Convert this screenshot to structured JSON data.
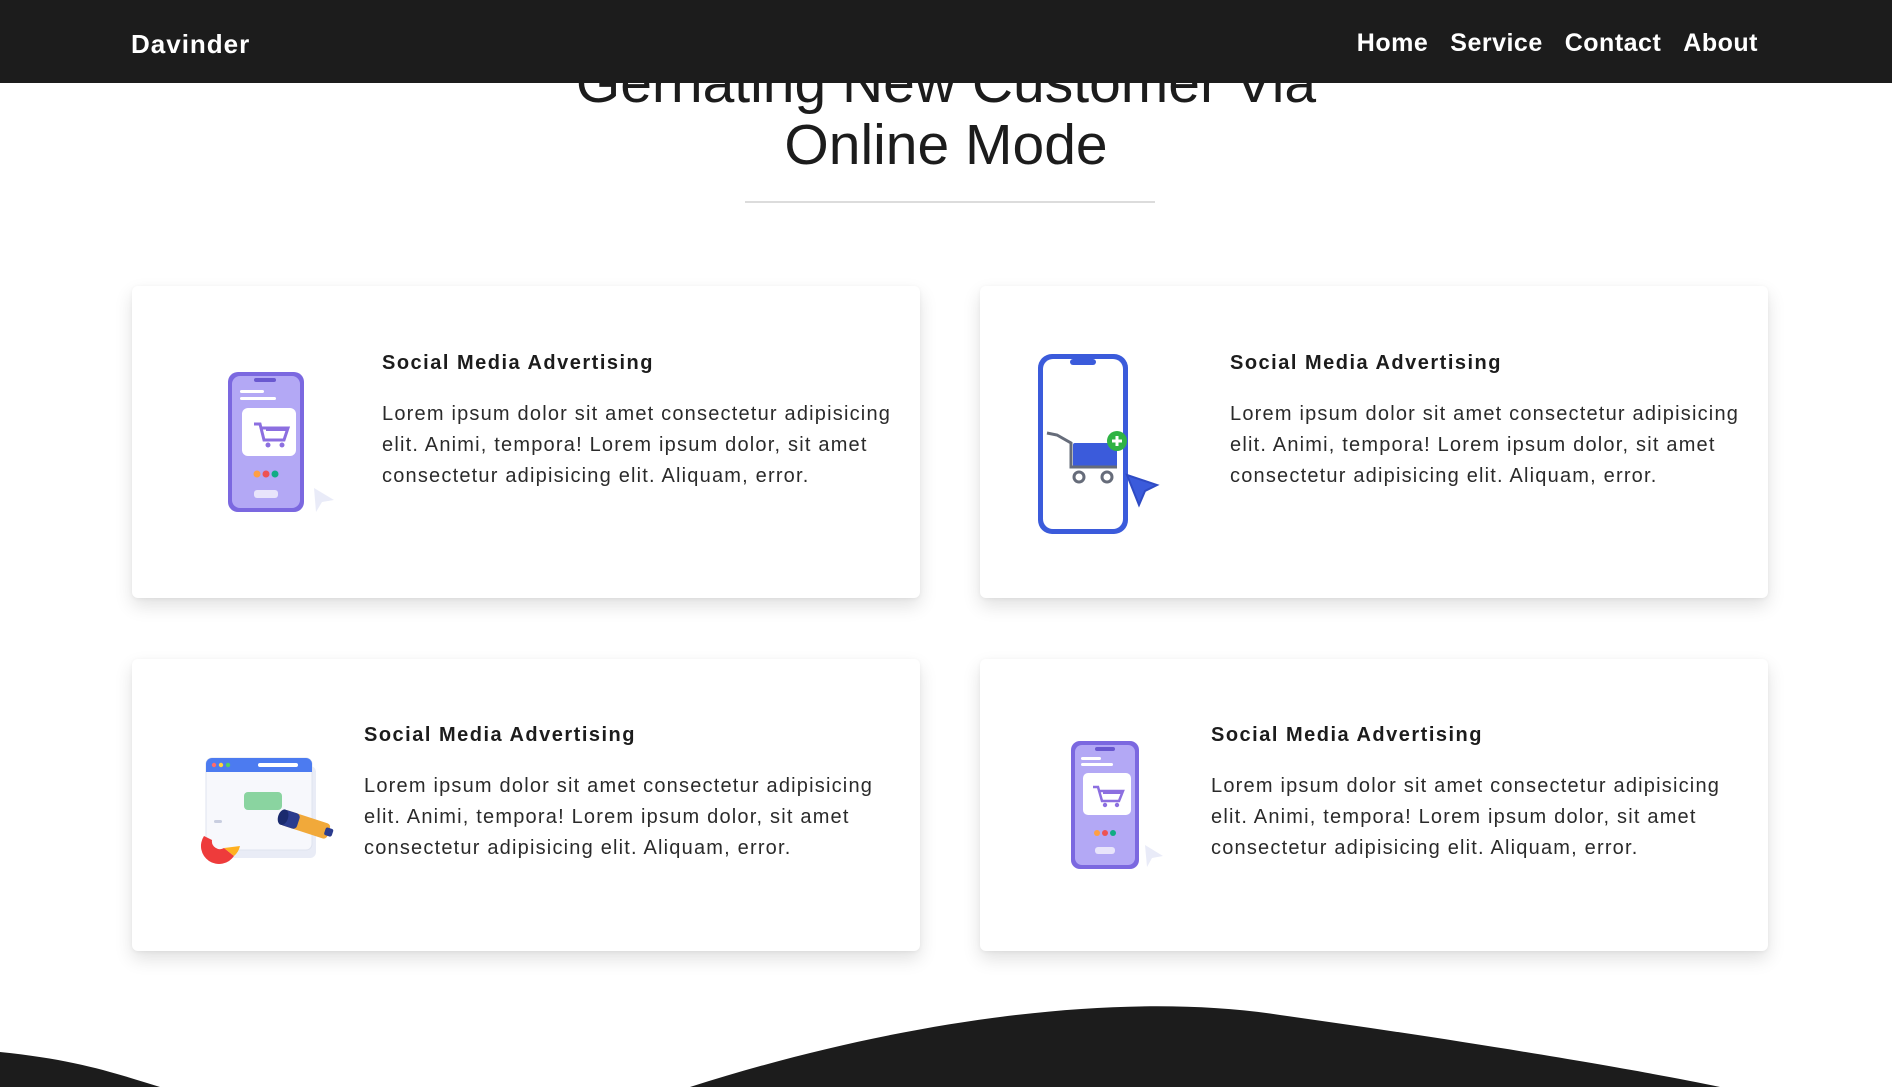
{
  "navbar": {
    "brand": "Davinder",
    "links": [
      "Home",
      "Service",
      "Contact",
      "About"
    ]
  },
  "heading": {
    "line1": "Gernating New Customer Via",
    "line2": "Online Mode"
  },
  "cards": [
    {
      "title": "Social Media Advertising",
      "text": "Lorem ipsum dolor sit amet consectetur adipisicing elit. Animi, tempora! Lorem ipsum dolor, sit amet consectetur adipisicing elit. Aliquam, error.",
      "icon": "phone-shopping-cart-icon"
    },
    {
      "title": "Social Media Advertising",
      "text": "Lorem ipsum dolor sit amet consectetur adipisicing elit. Animi, tempora! Lorem ipsum dolor, sit amet consectetur adipisicing elit. Aliquam, error.",
      "icon": "phone-cart-cursor-icon"
    },
    {
      "title": "Social Media Advertising",
      "text": "Lorem ipsum dolor sit amet consectetur adipisicing elit. Animi, tempora! Lorem ipsum dolor, sit amet consectetur adipisicing elit. Aliquam, error.",
      "icon": "browser-telescope-icon"
    },
    {
      "title": "Social Media Advertising",
      "text": "Lorem ipsum dolor sit amet consectetur adipisicing elit. Animi, tempora! Lorem ipsum dolor, sit amet consectetur adipisicing elit. Aliquam, error.",
      "icon": "phone-shopping-cart-icon"
    }
  ],
  "colors": {
    "navbar_bg": "#1c1c1c",
    "accent_purple": "#a99cf0",
    "accent_blue": "#3b5bdb"
  }
}
